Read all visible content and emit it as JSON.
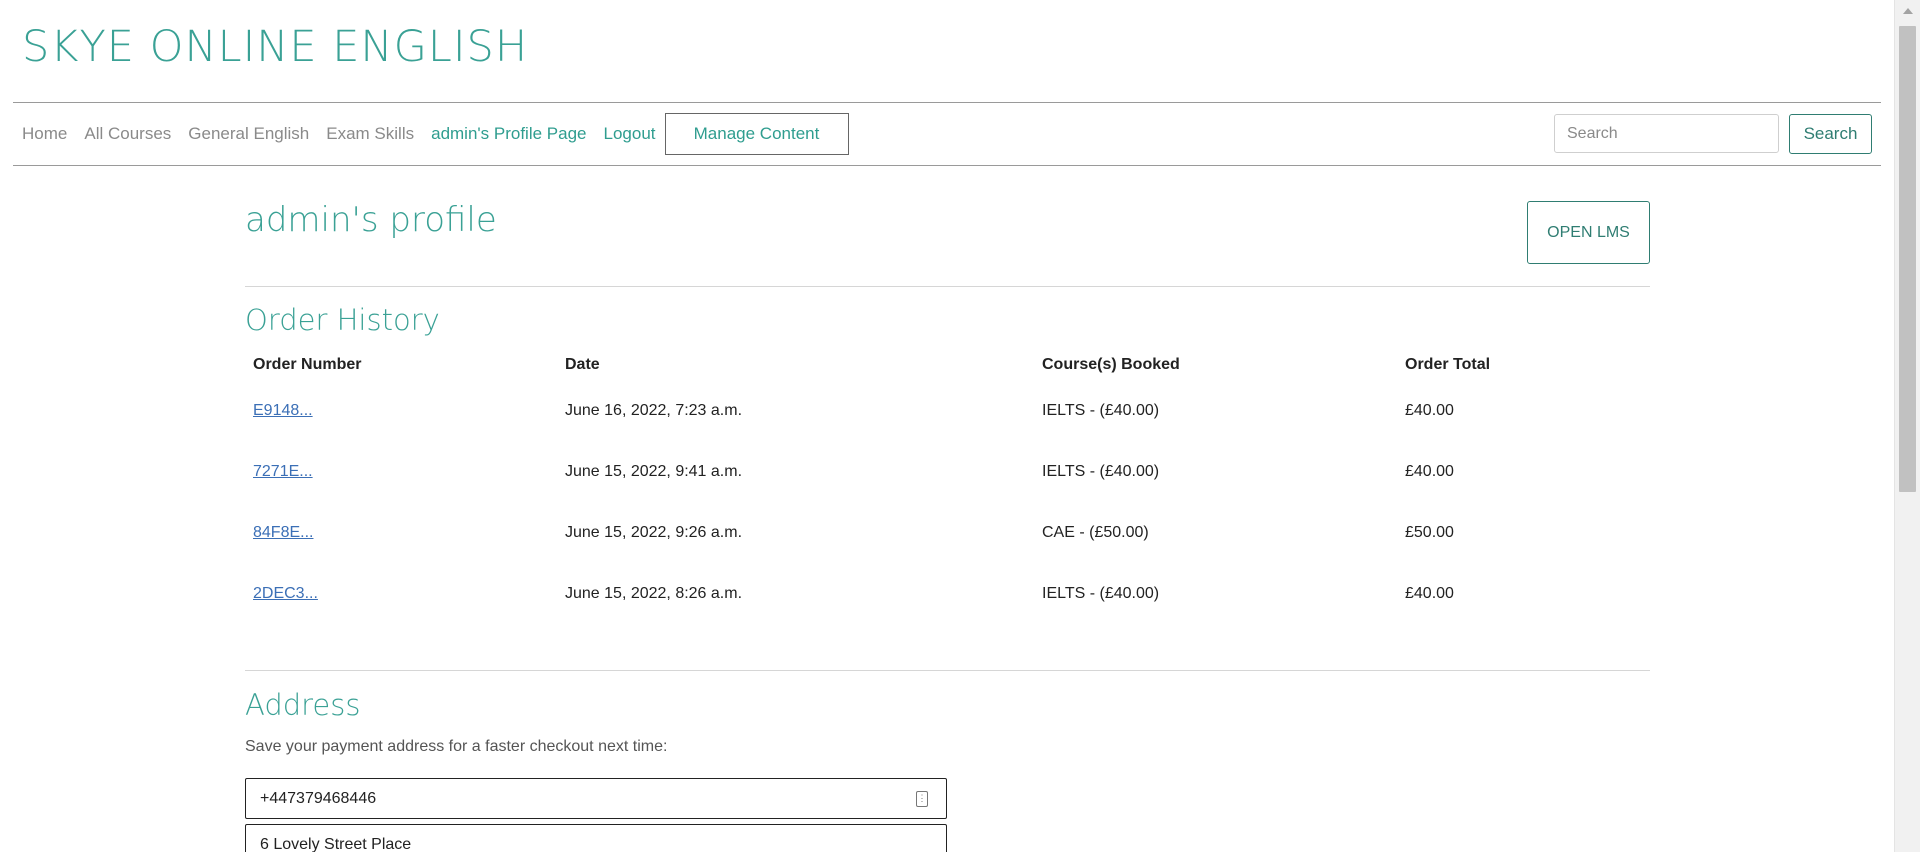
{
  "brand": {
    "title": "SKYE ONLINE ENGLISH"
  },
  "nav": {
    "links": [
      {
        "label": "Home"
      },
      {
        "label": "All Courses"
      },
      {
        "label": "General English"
      },
      {
        "label": "Exam Skills"
      },
      {
        "label": "admin's Profile Page"
      },
      {
        "label": "Logout"
      }
    ],
    "manage_content": "Manage Content",
    "search_placeholder": "Search",
    "search_button": "Search"
  },
  "profile": {
    "title": "admin's profile",
    "open_lms": "OPEN LMS"
  },
  "order_history": {
    "title": "Order History",
    "columns": [
      "Order Number",
      "Date",
      "Course(s) Booked",
      "Order Total"
    ],
    "rows": [
      {
        "order_number": "E9148...",
        "date": "June 16, 2022, 7:23 a.m.",
        "courses": "IELTS - (£40.00)",
        "total": "£40.00"
      },
      {
        "order_number": "7271E...",
        "date": "June 15, 2022, 9:41 a.m.",
        "courses": "IELTS - (£40.00)",
        "total": "£40.00"
      },
      {
        "order_number": "84F8E...",
        "date": "June 15, 2022, 9:26 a.m.",
        "courses": "CAE - (£50.00)",
        "total": "£50.00"
      },
      {
        "order_number": "2DEC3...",
        "date": "June 15, 2022, 8:26 a.m.",
        "courses": "IELTS - (£40.00)",
        "total": "£40.00"
      }
    ]
  },
  "address": {
    "title": "Address",
    "note": "Save your payment address for a faster checkout next time:",
    "phone": "+447379468446",
    "street": "6 Lovely Street Place"
  },
  "icons": {
    "field_icon": "contact-card-icon"
  }
}
